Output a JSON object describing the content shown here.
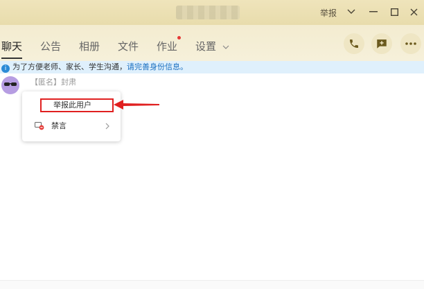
{
  "window": {
    "report_label": "举报"
  },
  "tabs": [
    {
      "label": "聊天",
      "active": true
    },
    {
      "label": "公告"
    },
    {
      "label": "相册"
    },
    {
      "label": "文件"
    },
    {
      "label": "作业",
      "badge": true
    },
    {
      "label": "设置"
    }
  ],
  "notice": {
    "text": "为了方便老师、家长、学生沟通，",
    "link": "请完善身份信息。"
  },
  "message": {
    "sender": "【匿名】封肃"
  },
  "context_menu": {
    "report_user": "举报此用户",
    "mute": "禁言"
  },
  "colors": {
    "accent_red": "#e02020",
    "notice_bg": "#dff0fc",
    "link_blue": "#1a6fc0",
    "header_bg": "#efe4bb"
  }
}
